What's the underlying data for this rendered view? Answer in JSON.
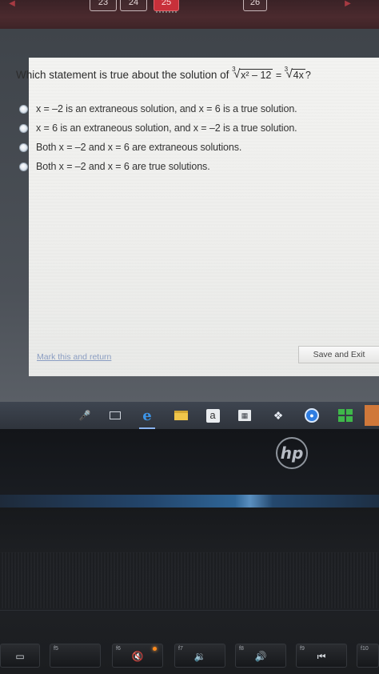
{
  "topnav": {
    "questions": [
      {
        "label": "23",
        "active": false
      },
      {
        "label": "24",
        "active": false
      },
      {
        "label": "25",
        "active": true
      },
      {
        "label": "26",
        "active": false
      }
    ]
  },
  "question": {
    "prompt": "Which statement is true about the solution of",
    "equation": {
      "lhs_index": "3",
      "lhs_radicand": "x² – 12",
      "equals": "=",
      "rhs_index": "3",
      "rhs_radicand": "4x",
      "suffix": "?"
    },
    "choices": [
      {
        "label": "x = –2 is an extraneous solution, and x = 6 is a true solution."
      },
      {
        "label": "x = 6 is an extraneous solution, and x = –2 is a true solution."
      },
      {
        "label": "Both x = –2 and x = 6 are extraneous solutions."
      },
      {
        "label": "Both x = –2 and x = 6 are true solutions."
      }
    ]
  },
  "footer": {
    "mark_link": "Mark this and return",
    "save_exit": "Save and Exit"
  },
  "taskbar": {
    "icons": [
      "microphone-icon",
      "task-view-icon",
      "edge-icon",
      "file-explorer-icon",
      "amazon-icon",
      "store-icon",
      "dropbox-icon",
      "dell-icon",
      "windows-icon"
    ],
    "amazon_glyph": "a"
  },
  "laptop": {
    "brand": "hp"
  },
  "keyboard": {
    "keys": [
      {
        "fn": "",
        "icon": "▭"
      },
      {
        "fn": "f5",
        "icon": ""
      },
      {
        "fn": "f6",
        "icon": "🔇"
      },
      {
        "fn": "f7",
        "icon": "🔉"
      },
      {
        "fn": "f8",
        "icon": "🔊"
      },
      {
        "fn": "f9",
        "icon": "⏮"
      },
      {
        "fn": "f10",
        "icon": ""
      }
    ]
  },
  "colors": {
    "accent_active_question": "#c8303a",
    "link": "#6b84b5",
    "edge_blue": "#3d95e8",
    "windows_green": "#3fb84a",
    "mute_led": "#ff8a1c"
  }
}
